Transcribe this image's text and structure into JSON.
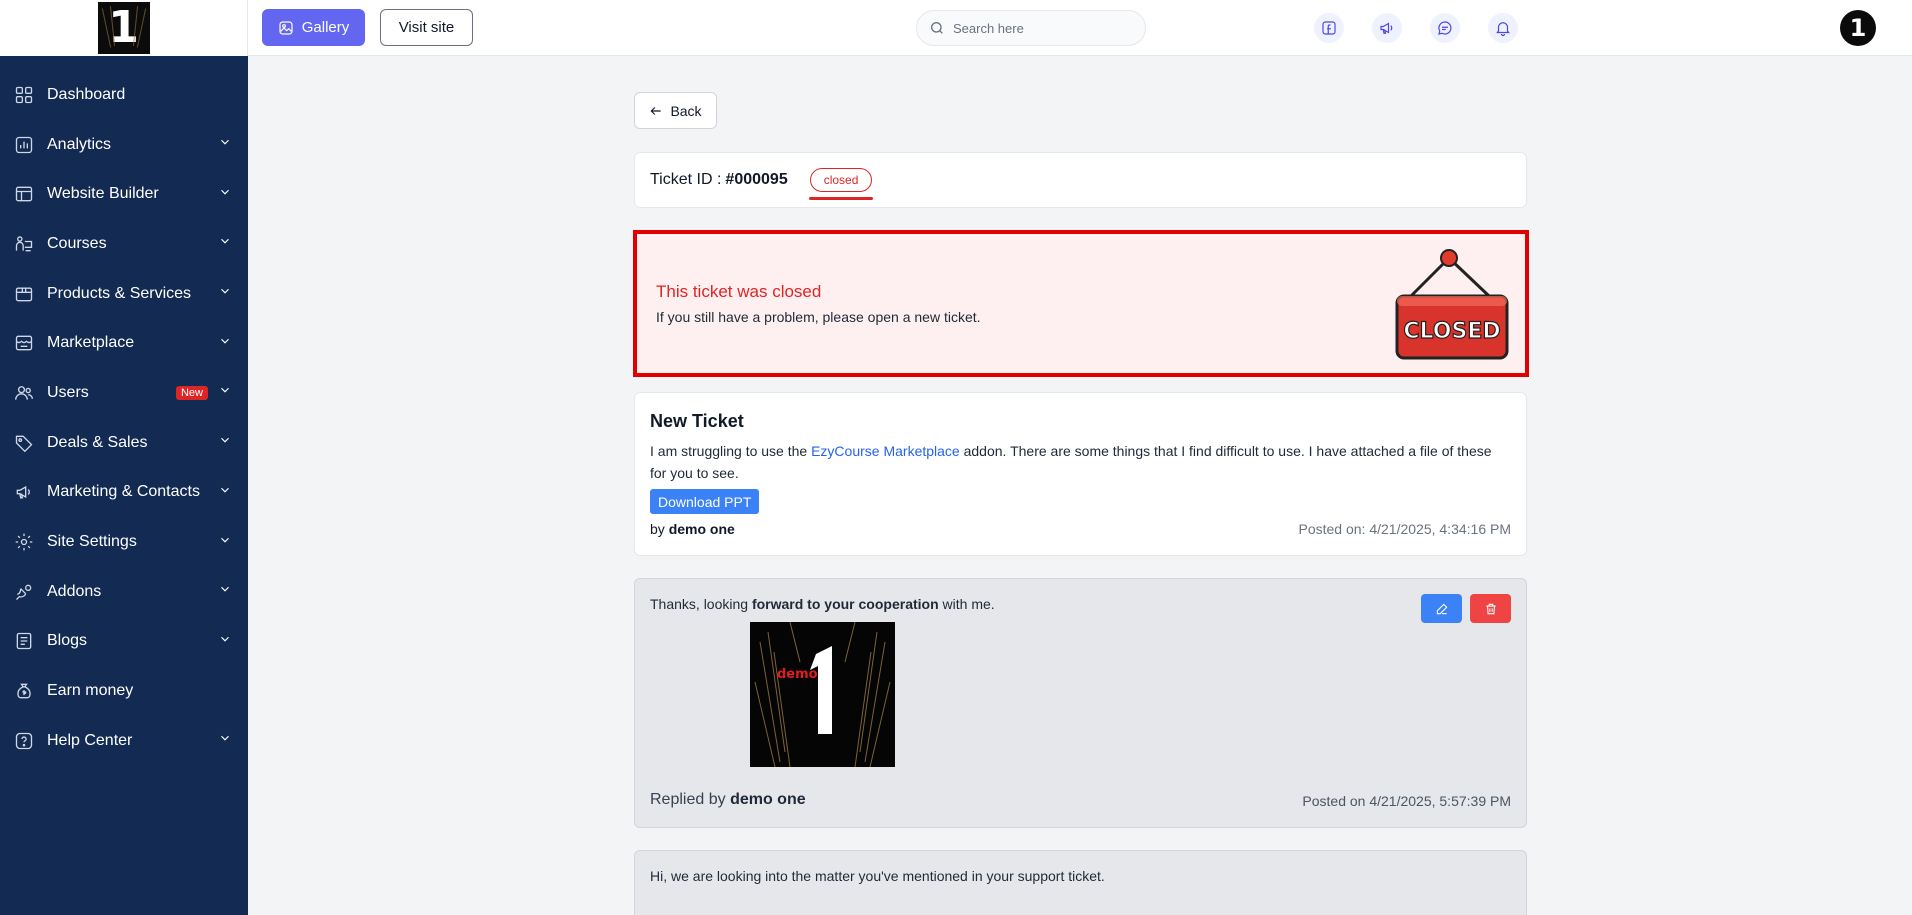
{
  "logo": {
    "glyph": "1"
  },
  "sidebar": {
    "items": [
      {
        "label": "Dashboard",
        "icon": "dashboard-icon",
        "chevron": false
      },
      {
        "label": "Analytics",
        "icon": "analytics-icon",
        "chevron": true
      },
      {
        "label": "Website Builder",
        "icon": "website-builder-icon",
        "chevron": true
      },
      {
        "label": "Courses",
        "icon": "courses-icon",
        "chevron": true
      },
      {
        "label": "Products & Services",
        "icon": "products-icon",
        "chevron": true
      },
      {
        "label": "Marketplace",
        "icon": "marketplace-icon",
        "chevron": true
      },
      {
        "label": "Users",
        "icon": "users-icon",
        "chevron": true,
        "badge": "New"
      },
      {
        "label": "Deals & Sales",
        "icon": "tag-icon",
        "chevron": true
      },
      {
        "label": "Marketing & Contacts",
        "icon": "megaphone-icon",
        "chevron": true
      },
      {
        "label": "Site Settings",
        "icon": "gear-icon",
        "chevron": true
      },
      {
        "label": "Addons",
        "icon": "addons-icon",
        "chevron": true
      },
      {
        "label": "Blogs",
        "icon": "blogs-icon",
        "chevron": true
      },
      {
        "label": "Earn money",
        "icon": "money-bag-icon",
        "chevron": false
      },
      {
        "label": "Help Center",
        "icon": "help-icon",
        "chevron": true
      }
    ]
  },
  "topbar": {
    "gallery_label": "Gallery",
    "visit_label": "Visit site",
    "search_placeholder": "Search here",
    "icons": [
      "facebook-icon",
      "megaphone-icon",
      "chat-icon",
      "bell-icon"
    ],
    "avatar_glyph": "1"
  },
  "back_label": "Back",
  "ticket": {
    "id_label": "Ticket ID :",
    "id_value": "#000095",
    "status": "closed"
  },
  "closed_alert": {
    "title": "This ticket was closed",
    "message": "If you still have a problem, please open a new ticket.",
    "sign_text": "CLOSED"
  },
  "new_ticket": {
    "title": "New Ticket",
    "body_before": "I am struggling to use the ",
    "body_link": "EzyCourse Marketplace",
    "body_after": " addon. There are some things that I find difficult to use. I have attached a file of these for you to see.",
    "download_label": "Download PPT",
    "by_prefix": "by",
    "author": "demo one",
    "posted": "Posted on: 4/21/2025, 4:34:16 PM"
  },
  "reply1": {
    "text_before": "Thanks, looking ",
    "text_bold": "forward to your cooperation",
    "text_after": " with me.",
    "image_text_small": "demo",
    "image_text_big": "1",
    "by_prefix": "Replied by",
    "author": "demo one",
    "posted": "Posted on 4/21/2025, 5:57:39 PM"
  },
  "reply2": {
    "text": "Hi, we are looking into the matter you've mentioned in your support ticket."
  },
  "colors": {
    "sidebar_bg": "#132a52",
    "accent": "#6366f1",
    "danger": "#e00000",
    "link": "#2563eb"
  }
}
